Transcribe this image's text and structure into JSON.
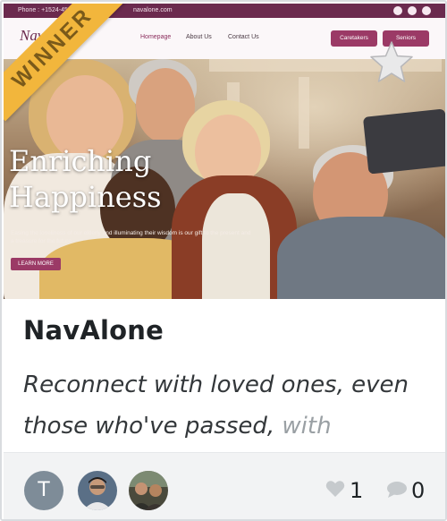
{
  "badge": {
    "label": "WINNER",
    "color": "#f2b63c"
  },
  "favorite_icon": "star-icon",
  "screenshot": {
    "topbar": {
      "phone": "Phone : +1524-456",
      "email": "navalone.com"
    },
    "nav": {
      "logo": "Nav",
      "links": [
        "Homepage",
        "About Us",
        "Contact Us"
      ],
      "buttons": [
        "Caretakers",
        "Seniors"
      ]
    },
    "headline": [
      "Enriching",
      "Happiness"
    ],
    "subline": "Easing the loneliness of our elderly and illuminating their wisdom is our gift to the present and a treasure for the future",
    "cta": "LEARN MORE"
  },
  "project": {
    "title": "NavAlone",
    "description": "Reconnect with loved ones, even those who've passed,",
    "description_fade": "with"
  },
  "footer": {
    "avatars": [
      {
        "type": "letter",
        "letter": "T",
        "color": "#7e8c98"
      },
      {
        "type": "photo"
      },
      {
        "type": "photo"
      }
    ],
    "likes": "1",
    "comments": "0",
    "like_icon": "heart-icon",
    "comment_icon": "comment-icon"
  }
}
